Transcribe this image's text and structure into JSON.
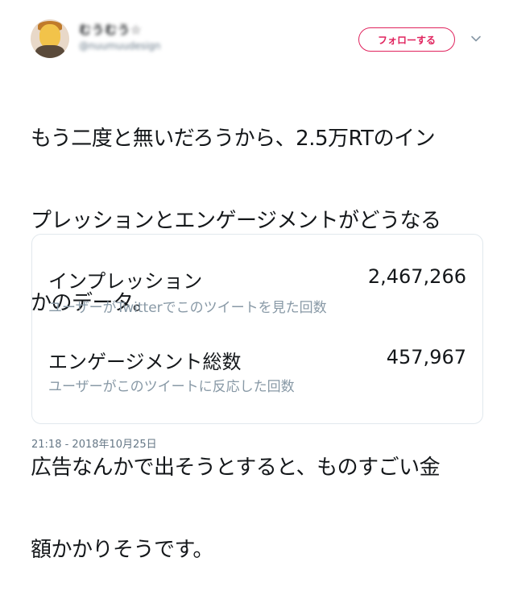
{
  "user": {
    "display_name": "むうむう☆",
    "handle": "@nuumuudesign"
  },
  "follow_button": {
    "label": "フォローする"
  },
  "icons": {
    "menu": "chevron-down-icon",
    "avatar": "avatar"
  },
  "tweet": {
    "lines": [
      "もう二度と無いだろうから、2.5万RTのイン",
      "プレッションとエンゲージメントがどうなる",
      "かのデータ。",
      "",
      "広告なんかで出そうとすると、ものすごい金",
      "額かかりそうです。"
    ]
  },
  "analytics": {
    "impressions": {
      "label": "インプレッション",
      "value": "2,467,266",
      "sub": "ユーザーがTwitterでこのツイートを見た回数"
    },
    "engagements": {
      "label": "エンゲージメント総数",
      "value": "457,967",
      "sub": "ユーザーがこのツイートに反応した回数"
    }
  },
  "timestamp": "21:18 - 2018年10月25日",
  "colors": {
    "accent": "#e0245e",
    "muted": "#8899a6",
    "border": "#e1e8ed"
  }
}
